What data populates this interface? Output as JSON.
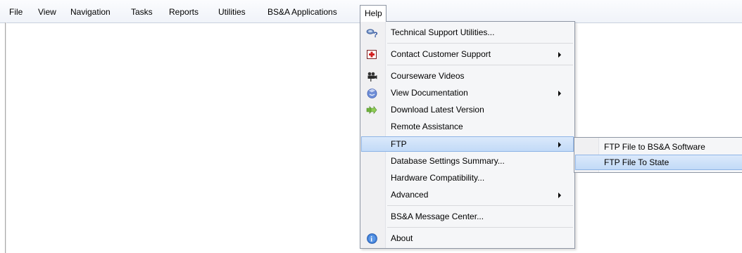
{
  "menubar": {
    "items": [
      "File",
      "View",
      "Navigation",
      "Tasks",
      "Reports",
      "Utilities",
      "BS&A Applications",
      "Help"
    ]
  },
  "help_menu": {
    "items": [
      {
        "label": "Technical Support Utilities...",
        "icon": "support-tools-icon"
      },
      {
        "label": "Contact Customer Support",
        "icon": "first-aid-icon",
        "submenu": true
      },
      {
        "label": "Courseware Videos",
        "icon": "video-camera-icon"
      },
      {
        "label": "View Documentation",
        "icon": "documentation-icon",
        "submenu": true
      },
      {
        "label": "Download Latest Version",
        "icon": "download-arrows-icon"
      },
      {
        "label": "Remote Assistance"
      },
      {
        "label": "FTP",
        "submenu": true,
        "highlighted": true
      },
      {
        "label": "Database Settings Summary..."
      },
      {
        "label": "Hardware Compatibility..."
      },
      {
        "label": "Advanced",
        "submenu": true
      },
      {
        "label": "BS&A Message Center..."
      },
      {
        "label": "About",
        "icon": "info-icon"
      }
    ]
  },
  "ftp_submenu": {
    "items": [
      {
        "label": "FTP File to BS&A Software"
      },
      {
        "label": "FTP File To State",
        "highlighted": true
      }
    ]
  },
  "colors": {
    "highlight_border": "#8eb4e6",
    "highlight_fill": "#c2daf7",
    "menu_background": "#f5f6f8"
  }
}
